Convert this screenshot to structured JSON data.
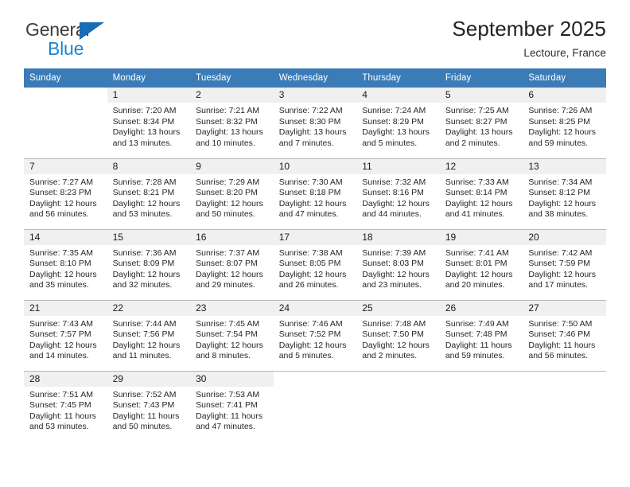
{
  "brand": {
    "name_part1": "General",
    "name_part2": "Blue",
    "accent_color": "#1f85d0",
    "triangle_color": "#1a6cb5"
  },
  "header": {
    "title": "September 2025",
    "subtitle": "Lectoure, France"
  },
  "calendar": {
    "header_bg": "#3b7cb8",
    "daynum_bg": "#f0f0f0",
    "weekdays": [
      "Sunday",
      "Monday",
      "Tuesday",
      "Wednesday",
      "Thursday",
      "Friday",
      "Saturday"
    ],
    "weeks": [
      [
        {
          "day": "",
          "sunrise": "",
          "sunset": "",
          "daylight_line1": "",
          "daylight_line2": ""
        },
        {
          "day": "1",
          "sunrise": "Sunrise: 7:20 AM",
          "sunset": "Sunset: 8:34 PM",
          "daylight_line1": "Daylight: 13 hours",
          "daylight_line2": "and 13 minutes."
        },
        {
          "day": "2",
          "sunrise": "Sunrise: 7:21 AM",
          "sunset": "Sunset: 8:32 PM",
          "daylight_line1": "Daylight: 13 hours",
          "daylight_line2": "and 10 minutes."
        },
        {
          "day": "3",
          "sunrise": "Sunrise: 7:22 AM",
          "sunset": "Sunset: 8:30 PM",
          "daylight_line1": "Daylight: 13 hours",
          "daylight_line2": "and 7 minutes."
        },
        {
          "day": "4",
          "sunrise": "Sunrise: 7:24 AM",
          "sunset": "Sunset: 8:29 PM",
          "daylight_line1": "Daylight: 13 hours",
          "daylight_line2": "and 5 minutes."
        },
        {
          "day": "5",
          "sunrise": "Sunrise: 7:25 AM",
          "sunset": "Sunset: 8:27 PM",
          "daylight_line1": "Daylight: 13 hours",
          "daylight_line2": "and 2 minutes."
        },
        {
          "day": "6",
          "sunrise": "Sunrise: 7:26 AM",
          "sunset": "Sunset: 8:25 PM",
          "daylight_line1": "Daylight: 12 hours",
          "daylight_line2": "and 59 minutes."
        }
      ],
      [
        {
          "day": "7",
          "sunrise": "Sunrise: 7:27 AM",
          "sunset": "Sunset: 8:23 PM",
          "daylight_line1": "Daylight: 12 hours",
          "daylight_line2": "and 56 minutes."
        },
        {
          "day": "8",
          "sunrise": "Sunrise: 7:28 AM",
          "sunset": "Sunset: 8:21 PM",
          "daylight_line1": "Daylight: 12 hours",
          "daylight_line2": "and 53 minutes."
        },
        {
          "day": "9",
          "sunrise": "Sunrise: 7:29 AM",
          "sunset": "Sunset: 8:20 PM",
          "daylight_line1": "Daylight: 12 hours",
          "daylight_line2": "and 50 minutes."
        },
        {
          "day": "10",
          "sunrise": "Sunrise: 7:30 AM",
          "sunset": "Sunset: 8:18 PM",
          "daylight_line1": "Daylight: 12 hours",
          "daylight_line2": "and 47 minutes."
        },
        {
          "day": "11",
          "sunrise": "Sunrise: 7:32 AM",
          "sunset": "Sunset: 8:16 PM",
          "daylight_line1": "Daylight: 12 hours",
          "daylight_line2": "and 44 minutes."
        },
        {
          "day": "12",
          "sunrise": "Sunrise: 7:33 AM",
          "sunset": "Sunset: 8:14 PM",
          "daylight_line1": "Daylight: 12 hours",
          "daylight_line2": "and 41 minutes."
        },
        {
          "day": "13",
          "sunrise": "Sunrise: 7:34 AM",
          "sunset": "Sunset: 8:12 PM",
          "daylight_line1": "Daylight: 12 hours",
          "daylight_line2": "and 38 minutes."
        }
      ],
      [
        {
          "day": "14",
          "sunrise": "Sunrise: 7:35 AM",
          "sunset": "Sunset: 8:10 PM",
          "daylight_line1": "Daylight: 12 hours",
          "daylight_line2": "and 35 minutes."
        },
        {
          "day": "15",
          "sunrise": "Sunrise: 7:36 AM",
          "sunset": "Sunset: 8:09 PM",
          "daylight_line1": "Daylight: 12 hours",
          "daylight_line2": "and 32 minutes."
        },
        {
          "day": "16",
          "sunrise": "Sunrise: 7:37 AM",
          "sunset": "Sunset: 8:07 PM",
          "daylight_line1": "Daylight: 12 hours",
          "daylight_line2": "and 29 minutes."
        },
        {
          "day": "17",
          "sunrise": "Sunrise: 7:38 AM",
          "sunset": "Sunset: 8:05 PM",
          "daylight_line1": "Daylight: 12 hours",
          "daylight_line2": "and 26 minutes."
        },
        {
          "day": "18",
          "sunrise": "Sunrise: 7:39 AM",
          "sunset": "Sunset: 8:03 PM",
          "daylight_line1": "Daylight: 12 hours",
          "daylight_line2": "and 23 minutes."
        },
        {
          "day": "19",
          "sunrise": "Sunrise: 7:41 AM",
          "sunset": "Sunset: 8:01 PM",
          "daylight_line1": "Daylight: 12 hours",
          "daylight_line2": "and 20 minutes."
        },
        {
          "day": "20",
          "sunrise": "Sunrise: 7:42 AM",
          "sunset": "Sunset: 7:59 PM",
          "daylight_line1": "Daylight: 12 hours",
          "daylight_line2": "and 17 minutes."
        }
      ],
      [
        {
          "day": "21",
          "sunrise": "Sunrise: 7:43 AM",
          "sunset": "Sunset: 7:57 PM",
          "daylight_line1": "Daylight: 12 hours",
          "daylight_line2": "and 14 minutes."
        },
        {
          "day": "22",
          "sunrise": "Sunrise: 7:44 AM",
          "sunset": "Sunset: 7:56 PM",
          "daylight_line1": "Daylight: 12 hours",
          "daylight_line2": "and 11 minutes."
        },
        {
          "day": "23",
          "sunrise": "Sunrise: 7:45 AM",
          "sunset": "Sunset: 7:54 PM",
          "daylight_line1": "Daylight: 12 hours",
          "daylight_line2": "and 8 minutes."
        },
        {
          "day": "24",
          "sunrise": "Sunrise: 7:46 AM",
          "sunset": "Sunset: 7:52 PM",
          "daylight_line1": "Daylight: 12 hours",
          "daylight_line2": "and 5 minutes."
        },
        {
          "day": "25",
          "sunrise": "Sunrise: 7:48 AM",
          "sunset": "Sunset: 7:50 PM",
          "daylight_line1": "Daylight: 12 hours",
          "daylight_line2": "and 2 minutes."
        },
        {
          "day": "26",
          "sunrise": "Sunrise: 7:49 AM",
          "sunset": "Sunset: 7:48 PM",
          "daylight_line1": "Daylight: 11 hours",
          "daylight_line2": "and 59 minutes."
        },
        {
          "day": "27",
          "sunrise": "Sunrise: 7:50 AM",
          "sunset": "Sunset: 7:46 PM",
          "daylight_line1": "Daylight: 11 hours",
          "daylight_line2": "and 56 minutes."
        }
      ],
      [
        {
          "day": "28",
          "sunrise": "Sunrise: 7:51 AM",
          "sunset": "Sunset: 7:45 PM",
          "daylight_line1": "Daylight: 11 hours",
          "daylight_line2": "and 53 minutes."
        },
        {
          "day": "29",
          "sunrise": "Sunrise: 7:52 AM",
          "sunset": "Sunset: 7:43 PM",
          "daylight_line1": "Daylight: 11 hours",
          "daylight_line2": "and 50 minutes."
        },
        {
          "day": "30",
          "sunrise": "Sunrise: 7:53 AM",
          "sunset": "Sunset: 7:41 PM",
          "daylight_line1": "Daylight: 11 hours",
          "daylight_line2": "and 47 minutes."
        },
        {
          "day": "",
          "sunrise": "",
          "sunset": "",
          "daylight_line1": "",
          "daylight_line2": ""
        },
        {
          "day": "",
          "sunrise": "",
          "sunset": "",
          "daylight_line1": "",
          "daylight_line2": ""
        },
        {
          "day": "",
          "sunrise": "",
          "sunset": "",
          "daylight_line1": "",
          "daylight_line2": ""
        },
        {
          "day": "",
          "sunrise": "",
          "sunset": "",
          "daylight_line1": "",
          "daylight_line2": ""
        }
      ]
    ]
  }
}
